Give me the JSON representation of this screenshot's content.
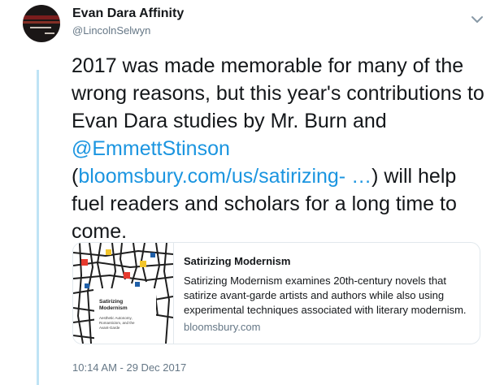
{
  "user": {
    "name": "Evan Dara Affinity",
    "handle": "@LincolnSelwyn"
  },
  "tweet": {
    "text_1": "2017 was made memorable for many of the wrong reasons, but this year's contributions to Evan Dara studies by Mr. Burn and ",
    "mention": "@EmmettStinson",
    "text_2": " (",
    "link": "bloomsbury.com/us/satirizing- …",
    "text_3": ") will help fuel readers and scholars for a long time to come."
  },
  "card": {
    "title": "Satirizing Modernism",
    "description": "Satirizing Modernism examines 20th-century novels that satirize avant-garde artists and authors while also using experimental techniques associated with literary modernism.",
    "domain": "bloomsbury.com",
    "thumb_title": "Satirizing Modernism",
    "thumb_sub": "Aesthetic Autonomy, Romanticism, and the Avant-Garde"
  },
  "timestamp": "10:14 AM - 29 Dec 2017",
  "colors": {
    "link": "#1b95e0",
    "thread_line": "#bfe3f5",
    "secondary_text": "#657786",
    "border": "#e1e8ed"
  },
  "icons": {
    "menu": "chevron-down-icon"
  }
}
